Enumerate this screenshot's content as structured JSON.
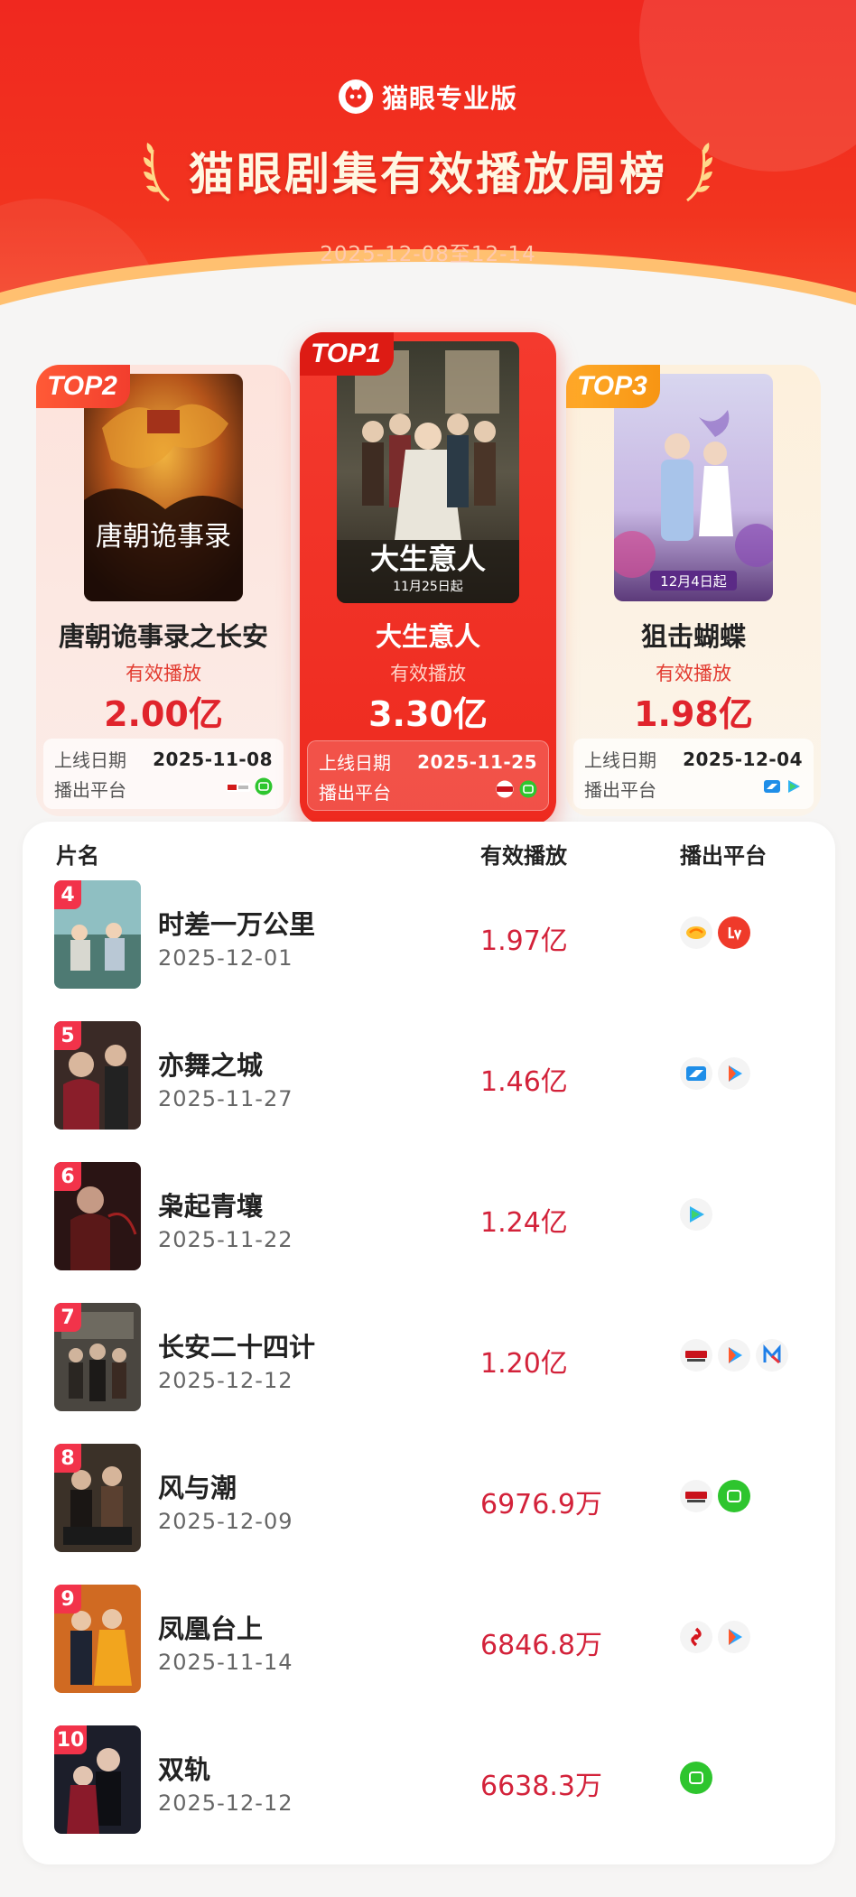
{
  "header": {
    "brand": "猫眼专业版",
    "title": "猫眼剧集有效播放周榜",
    "date_range": "2025-12-08至12-14"
  },
  "top3": {
    "first": {
      "badge": "TOP1",
      "name": "大生意人",
      "metric_label": "有效播放",
      "value": "3.30亿",
      "release_label": "上线日期",
      "release_date": "2025-11-25",
      "platform_label": "播出平台",
      "poster_text": "大生意人",
      "poster_date": "11月25日起"
    },
    "second": {
      "badge": "TOP2",
      "name": "唐朝诡事录之长安",
      "metric_label": "有效播放",
      "value": "2.00亿",
      "release_label": "上线日期",
      "release_date": "2025-11-08",
      "platform_label": "播出平台",
      "poster_text": "唐朝诡事录"
    },
    "third": {
      "badge": "TOP3",
      "name": "狙击蝴蝶",
      "metric_label": "有效播放",
      "value": "1.98亿",
      "release_label": "上线日期",
      "release_date": "2025-12-04",
      "platform_label": "播出平台",
      "poster_date": "12月4日起"
    }
  },
  "table": {
    "headers": {
      "name": "片名",
      "views": "有效播放",
      "platform": "播出平台"
    },
    "rows": [
      {
        "rank": "4",
        "name": "时差一万公里",
        "date": "2025-12-01",
        "views": "1.97亿",
        "platforms": [
          "mango-icon",
          "letv-icon"
        ]
      },
      {
        "rank": "5",
        "name": "亦舞之城",
        "date": "2025-11-27",
        "views": "1.46亿",
        "platforms": [
          "zjtv-icon",
          "youku-icon"
        ]
      },
      {
        "rank": "6",
        "name": "枭起青壤",
        "date": "2025-11-22",
        "views": "1.24亿",
        "platforms": [
          "tencent-video-icon"
        ]
      },
      {
        "rank": "7",
        "name": "长安二十四计",
        "date": "2025-12-12",
        "views": "1.20亿",
        "platforms": [
          "cctv-icon",
          "youku-icon",
          "migu-icon"
        ]
      },
      {
        "rank": "8",
        "name": "风与潮",
        "date": "2025-12-09",
        "views": "6976.9万",
        "platforms": [
          "cctv-icon",
          "iqiyi-icon"
        ]
      },
      {
        "rank": "9",
        "name": "凤凰台上",
        "date": "2025-11-14",
        "views": "6846.8万",
        "platforms": [
          "dragon-tv-icon",
          "youku-icon"
        ]
      },
      {
        "rank": "10",
        "name": "双轨",
        "date": "2025-12-12",
        "views": "6638.3万",
        "platforms": [
          "iqiyi-icon"
        ]
      }
    ]
  },
  "colors": {
    "header_red": "#f0281f",
    "accent_red": "#e0242c",
    "rank_red": "#f2334a",
    "top3_orange": "#f79513"
  }
}
